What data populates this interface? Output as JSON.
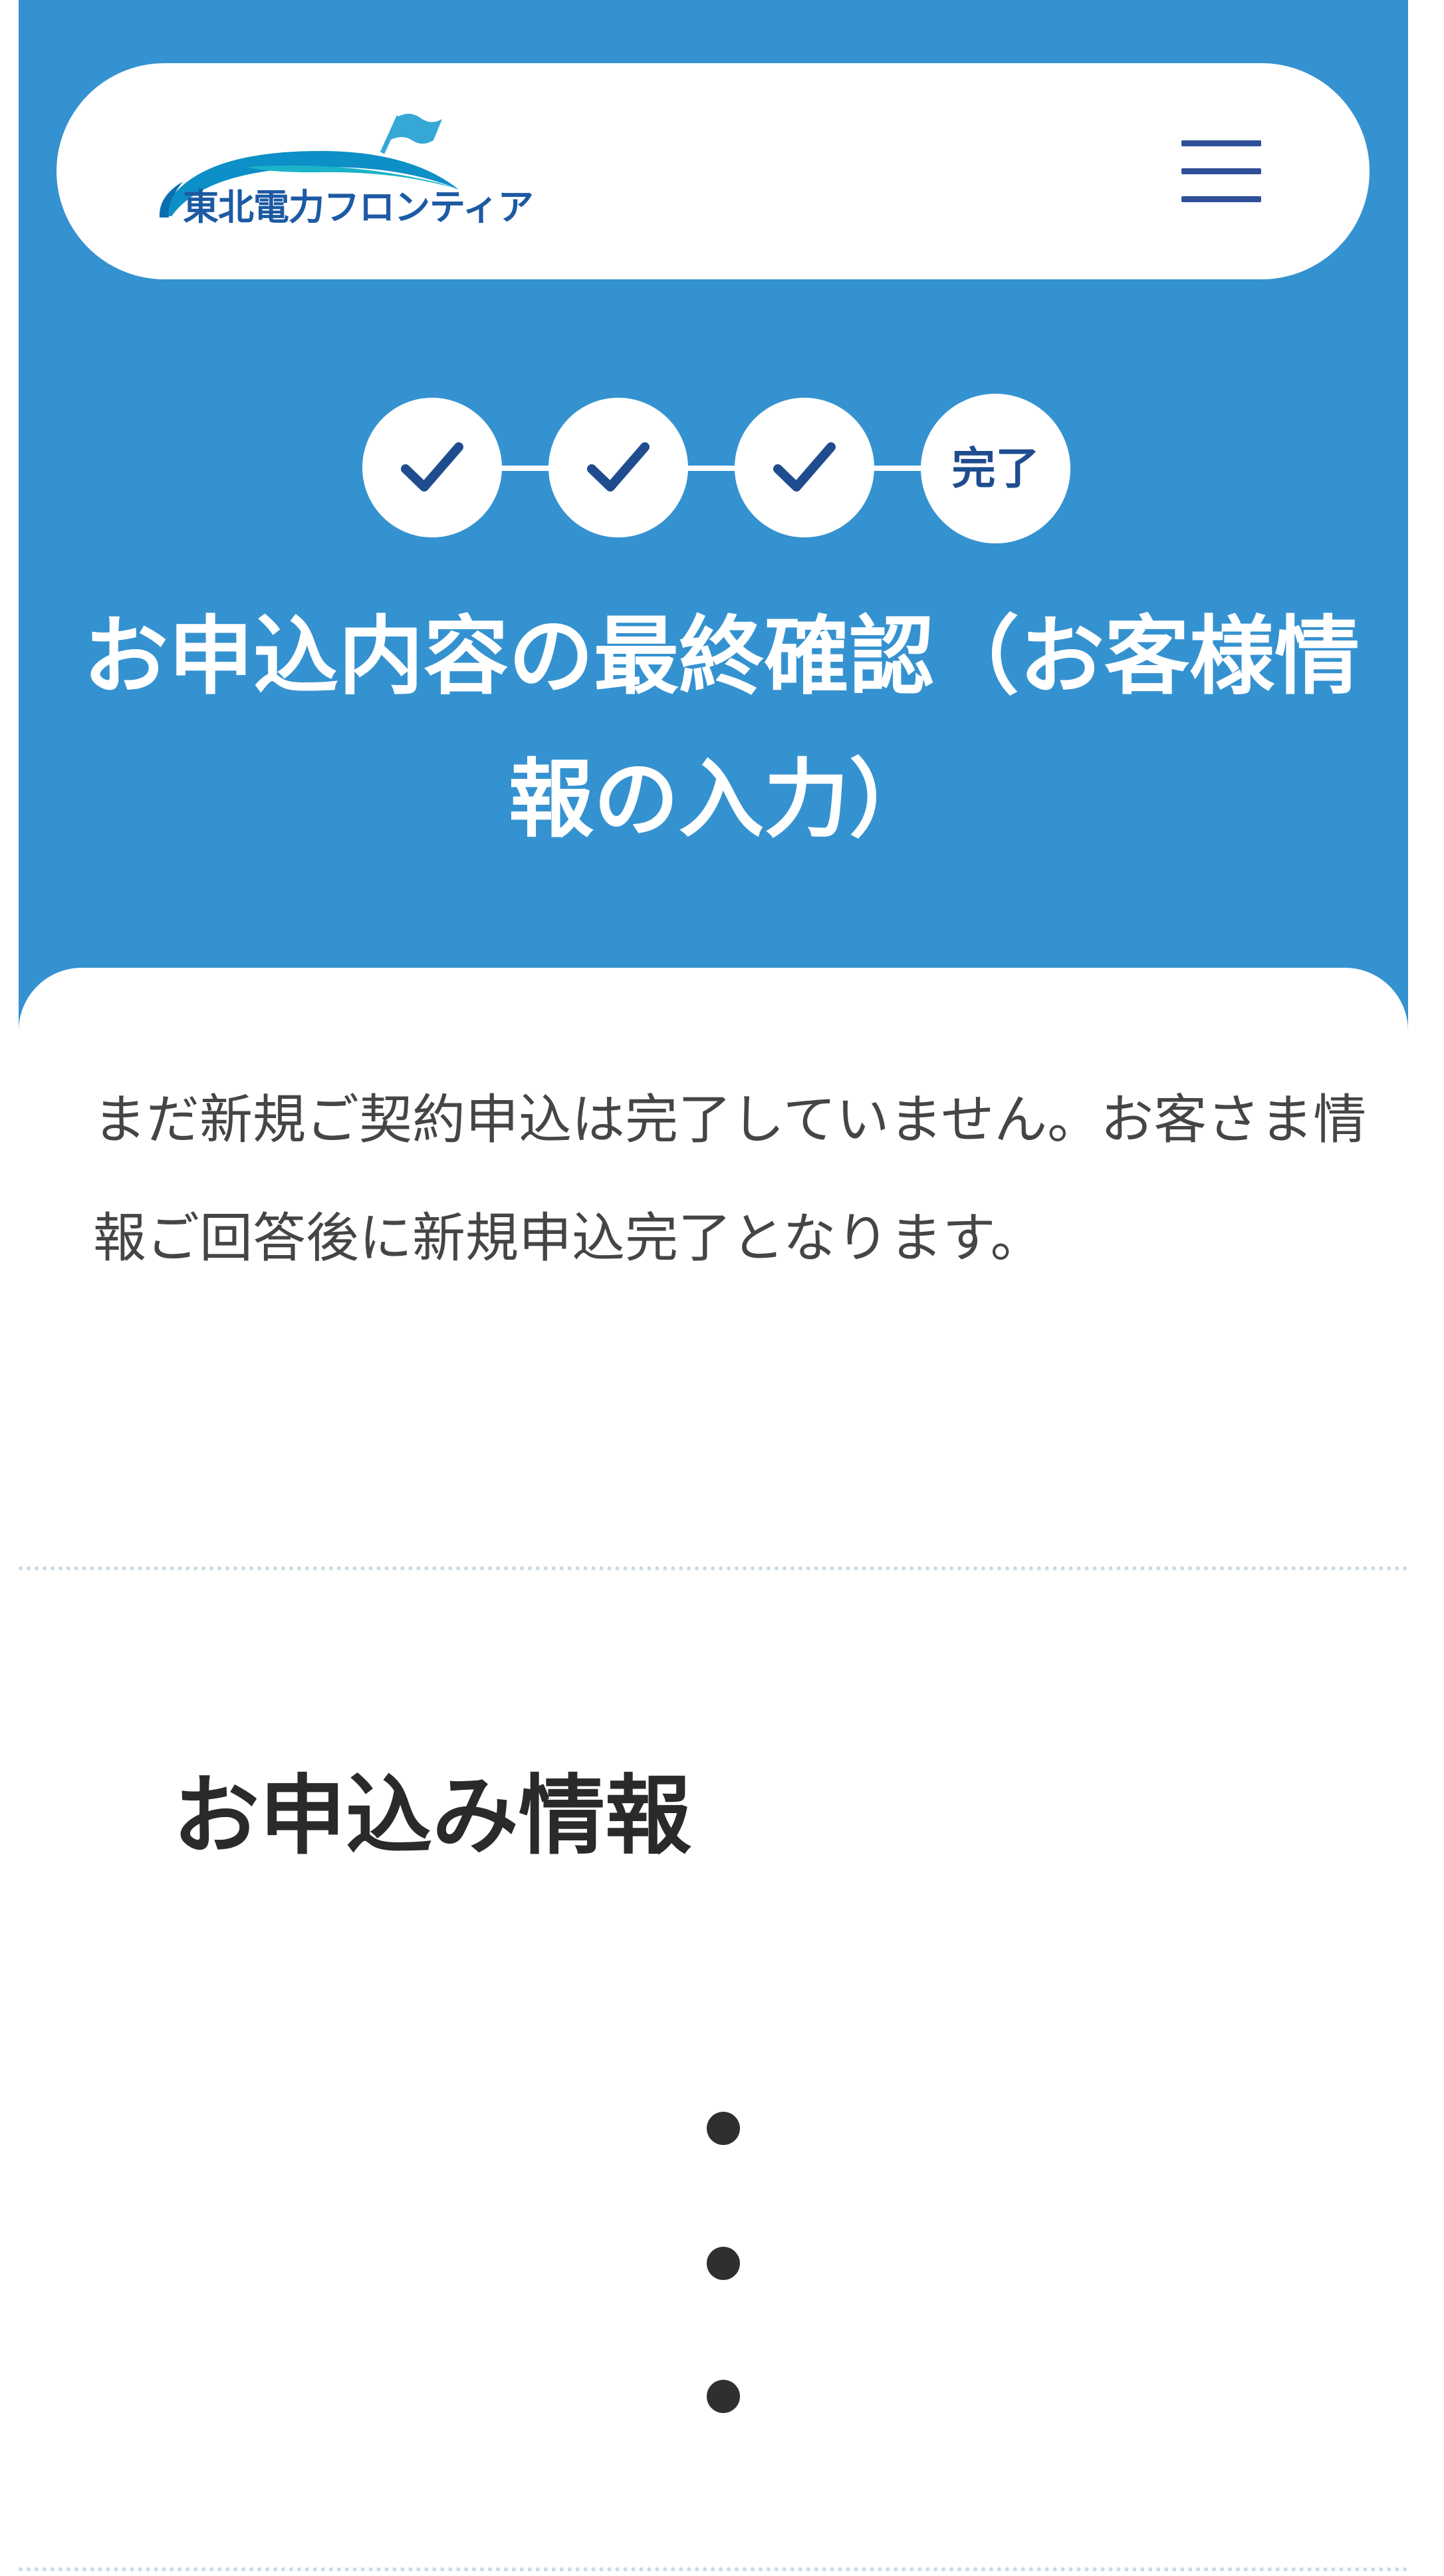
{
  "header": {
    "logo_text": "東北電力フロンティア",
    "menu_label": "メニュー"
  },
  "stepper": {
    "steps": [
      {
        "state": "done",
        "icon": "check-icon"
      },
      {
        "state": "done",
        "icon": "check-icon"
      },
      {
        "state": "done",
        "icon": "check-icon"
      },
      {
        "state": "current",
        "label": "完了"
      }
    ]
  },
  "page": {
    "title": "お申込内容の最終確認（お客様情報の入力）"
  },
  "notice": {
    "text": "まだ新規ご契約申込は完了していません。お客さま情報ご回答後に新規申込完了となります。"
  },
  "section": {
    "heading": "お申込み情報"
  },
  "colors": {
    "primary_blue": "#3592d0",
    "logo_navy": "#1d5aa3",
    "menu_icon": "#2f4f99",
    "text_dark": "#2a2a2a",
    "text_body": "#454545",
    "divider": "#c9d9e3"
  }
}
